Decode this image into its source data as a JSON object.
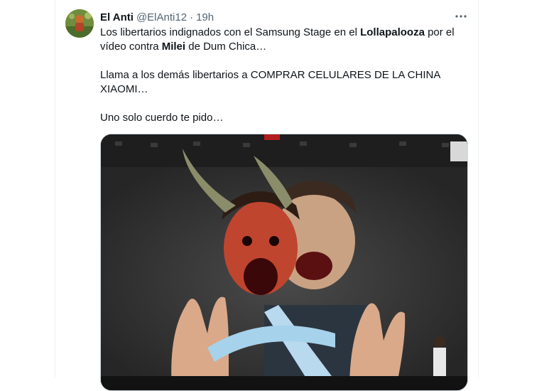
{
  "tweet": {
    "display_name": "El Anti",
    "handle": "@ElAnti12",
    "separator": "·",
    "time": "19h",
    "more_icon": "more-horizontal-icon",
    "text": {
      "p1_a": "Los libertarios indignados con el Samsung Stage en el ",
      "p1_b": "Lollapalooza",
      "p1_c": " por el vídeo contra ",
      "p1_d": "Milei",
      "p1_e": " de Dum Chica…",
      "p2": "Llama a los demás libertarios a COMPRAR CELULARES DE LA CHINA XIAOMI…",
      "p3": "Uno solo cuerdo te pido…"
    },
    "media_description_icon": "concert-screen-photo"
  },
  "colors": {
    "text_primary": "#0f1419",
    "text_secondary": "#536471",
    "border": "#cfd9de"
  }
}
